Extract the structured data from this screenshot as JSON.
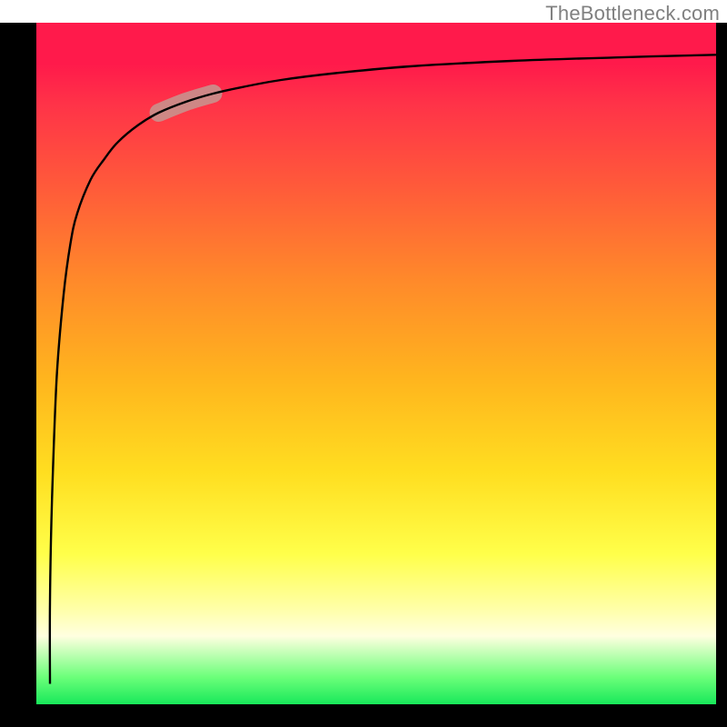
{
  "attribution": "TheBottleneck.com",
  "colors": {
    "frame": "#000000",
    "curve": "#000000",
    "highlight": "#c59690",
    "attribution_text": "#808080"
  },
  "chart_data": {
    "type": "line",
    "title": "",
    "xlabel": "",
    "ylabel": "",
    "xlim": [
      0,
      100
    ],
    "ylim": [
      0,
      100
    ],
    "grid": false,
    "legend": false,
    "series": [
      {
        "name": "bottleneck-curve",
        "x": [
          2,
          2,
          2.3,
          3,
          4,
          5,
          6,
          8,
          10,
          12,
          15,
          18,
          22,
          26,
          30,
          36,
          44,
          55,
          70,
          85,
          100
        ],
        "y": [
          3,
          15,
          30,
          48,
          60,
          67.5,
          72,
          77,
          80,
          82.5,
          85,
          86.8,
          88.4,
          89.6,
          90.5,
          91.6,
          92.6,
          93.6,
          94.4,
          94.9,
          95.3
        ]
      }
    ],
    "annotations": [
      {
        "name": "highlight-segment",
        "x_range": [
          18,
          26
        ],
        "note": "thick semi-transparent highlight over curve near upper-left bend"
      }
    ]
  }
}
